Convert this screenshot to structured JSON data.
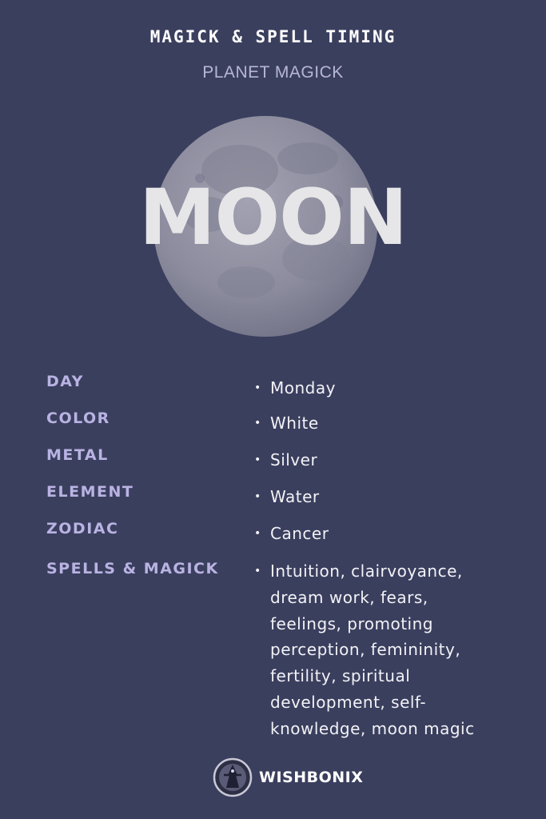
{
  "header": {
    "kicker": "MAGICK & SPELL TIMING",
    "subtitle": "PLANET MAGICK"
  },
  "planet": {
    "name": "MOON"
  },
  "correspondences": [
    {
      "label": "DAY",
      "value": "Monday"
    },
    {
      "label": "COLOR",
      "value": "White"
    },
    {
      "label": "METAL",
      "value": "Silver"
    },
    {
      "label": "ELEMENT",
      "value": "Water"
    },
    {
      "label": "ZODIAC",
      "value": "Cancer"
    },
    {
      "label": "SPELLS & MAGICK",
      "value": "Intuition, clairvoyance, dream work, fears, feelings, promoting perception, femininity, fertility, spiritual development, self-knowledge, moon magic"
    }
  ],
  "bullet": "•",
  "brand": {
    "name": "WISHBONIX",
    "icon": "witch-logo-icon"
  },
  "colors": {
    "background": "#3b3f5e",
    "label": "#b9b3e3",
    "subtitle": "#b8b6d6",
    "value": "#f2f2f6",
    "moon": "#8f8fa0"
  }
}
